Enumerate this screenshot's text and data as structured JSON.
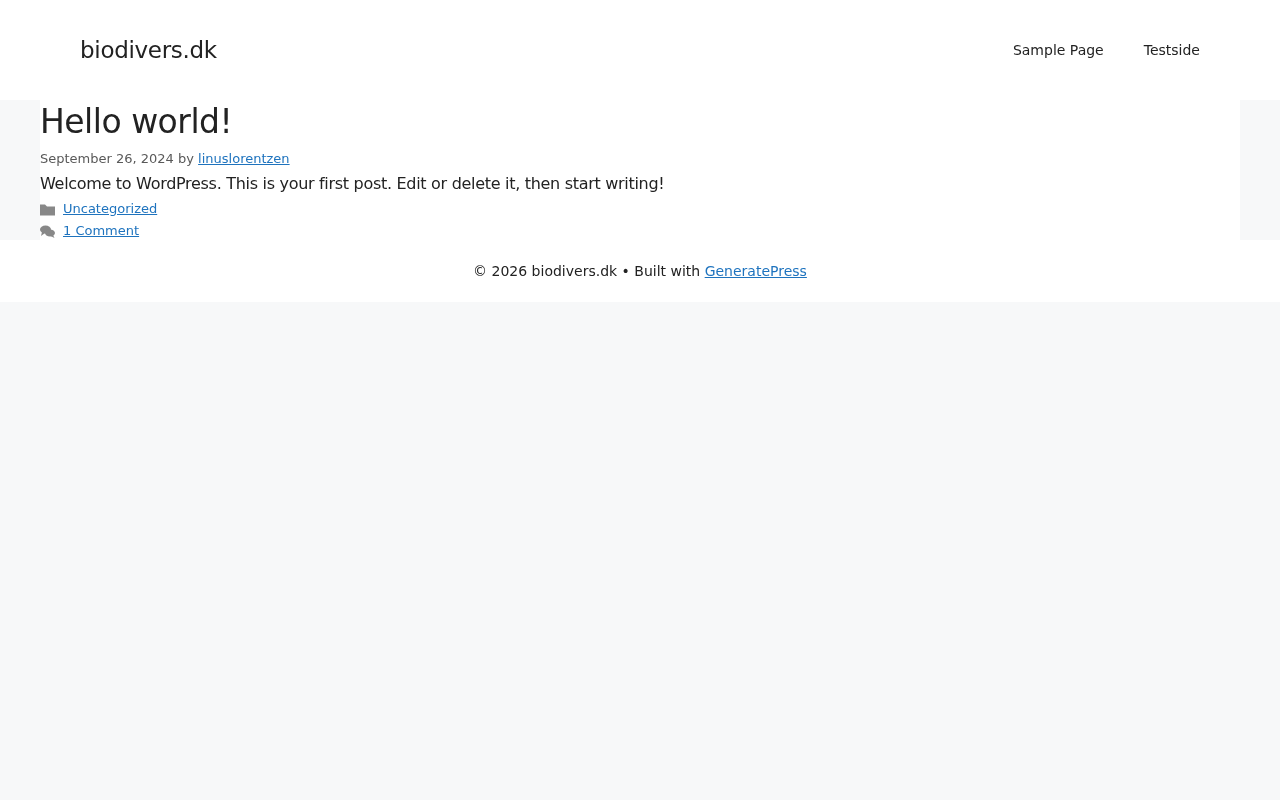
{
  "header": {
    "site_title": "biodivers.dk",
    "nav": [
      {
        "label": "Sample Page"
      },
      {
        "label": "Testside"
      }
    ]
  },
  "post": {
    "title": "Hello world!",
    "meta_prefix": "September 26, 2024 by",
    "author": "linuslorentzen",
    "body": "Welcome to WordPress. This is your first post. Edit or delete it, then start writing!",
    "category": "Uncategorized",
    "comments": "1 Comment"
  },
  "footer": {
    "prefix": "© 2026 biodivers.dk • Built with",
    "link": "GeneratePress"
  }
}
